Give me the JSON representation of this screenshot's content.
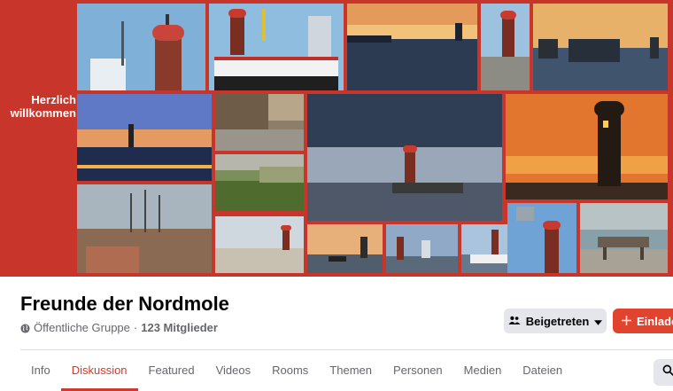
{
  "cover": {
    "welcome_line1": "Herzlich",
    "welcome_line2": "willkommen",
    "photos": [
      "photo-lighthouse-with-ship-mast",
      "photo-pilot-boat-lighthouse",
      "photo-sunset-pier",
      "photo-lighthouse-on-pier",
      "photo-ship-passing-pier",
      "photo-night-harbor-lights",
      "photo-rusty-breakwater",
      "photo-mossy-stones",
      "photo-storm-clouds-lighthouse",
      "photo-orange-sky-lighthouse",
      "photo-tall-ship-harbor",
      "photo-lighthouse-calm-water",
      "photo-sunset-boat",
      "photo-lighthouse-city-skyline",
      "photo-ferry-lighthouse",
      "photo-lighthouse-blue-sky",
      "photo-bench-waterfront"
    ]
  },
  "group": {
    "title": "Freunde der Nordmole",
    "privacy": "Öffentliche Gruppe",
    "separator": "·",
    "members": "123 Mitglieder"
  },
  "actions": {
    "joined_label": "Beigetreten",
    "invite_label": "Einladen"
  },
  "tabs": [
    {
      "label": "Info",
      "active": false
    },
    {
      "label": "Diskussion",
      "active": true
    },
    {
      "label": "Featured",
      "active": false
    },
    {
      "label": "Videos",
      "active": false
    },
    {
      "label": "Rooms",
      "active": false
    },
    {
      "label": "Themen",
      "active": false
    },
    {
      "label": "Personen",
      "active": false
    },
    {
      "label": "Medien",
      "active": false
    },
    {
      "label": "Dateien",
      "active": false
    }
  ],
  "colors": {
    "cover_background": "#c8352a",
    "accent": "#d0392b",
    "invite_button": "#e0442f",
    "secondary_button": "#e4e6eb"
  },
  "icons": {
    "privacy": "globe-icon",
    "joined": "people-icon",
    "dropdown": "caret-down-icon",
    "invite": "plus-icon",
    "search": "search-icon"
  }
}
